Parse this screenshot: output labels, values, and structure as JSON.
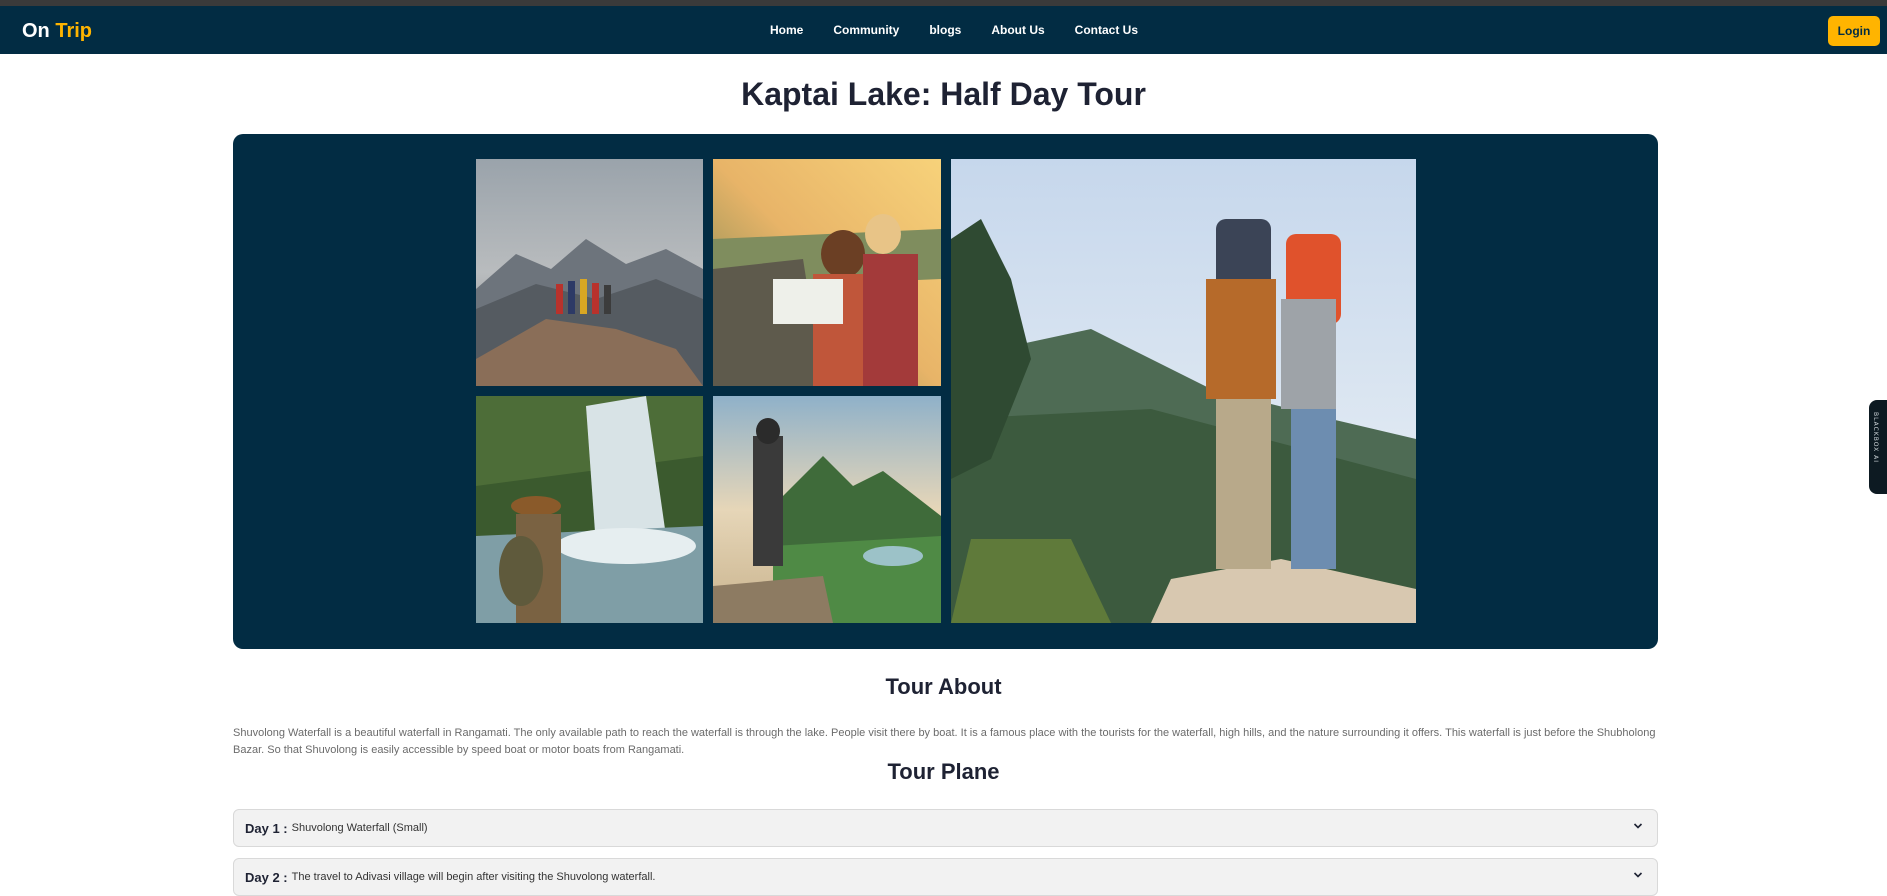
{
  "brand": {
    "name_part1": "On",
    "name_part2": "Trip"
  },
  "nav": {
    "items": [
      {
        "label": "Home"
      },
      {
        "label": "Community"
      },
      {
        "label": "blogs"
      },
      {
        "label": "About Us"
      },
      {
        "label": "Contact Us"
      }
    ],
    "login_label": "Login"
  },
  "page": {
    "title": "Kaptai Lake: Half Day Tour"
  },
  "gallery": {
    "images": [
      {
        "alt": "group on mountain peak"
      },
      {
        "alt": "hikers reading a map"
      },
      {
        "alt": "hiker pointing at waterfall"
      },
      {
        "alt": "photographer on cliff"
      },
      {
        "alt": "couple of backpackers"
      }
    ]
  },
  "about": {
    "heading": "Tour About",
    "text": "Shuvolong Waterfall is a beautiful waterfall in Rangamati. The only available path to reach the waterfall is through the lake. People visit there by boat. It is a famous place with the tourists for the waterfall, high hills, and the nature surrounding it offers. This waterfall is just before the Shubholong Bazar. So that Shuvolong is easily accessible by speed boat or motor boats from Rangamati."
  },
  "plan": {
    "heading": "Tour Plane",
    "days": [
      {
        "day": "Day 1 :",
        "text": "Shuvolong Waterfall (Small)"
      },
      {
        "day": "Day 2 :",
        "text": "The travel to Adivasi village will begin after visiting the Shuvolong waterfall."
      }
    ]
  },
  "side_widget": {
    "label": "BLACKBOX AI"
  },
  "colors": {
    "navy": "#022c43",
    "accent": "#ffb400",
    "text": "#1e2233"
  }
}
